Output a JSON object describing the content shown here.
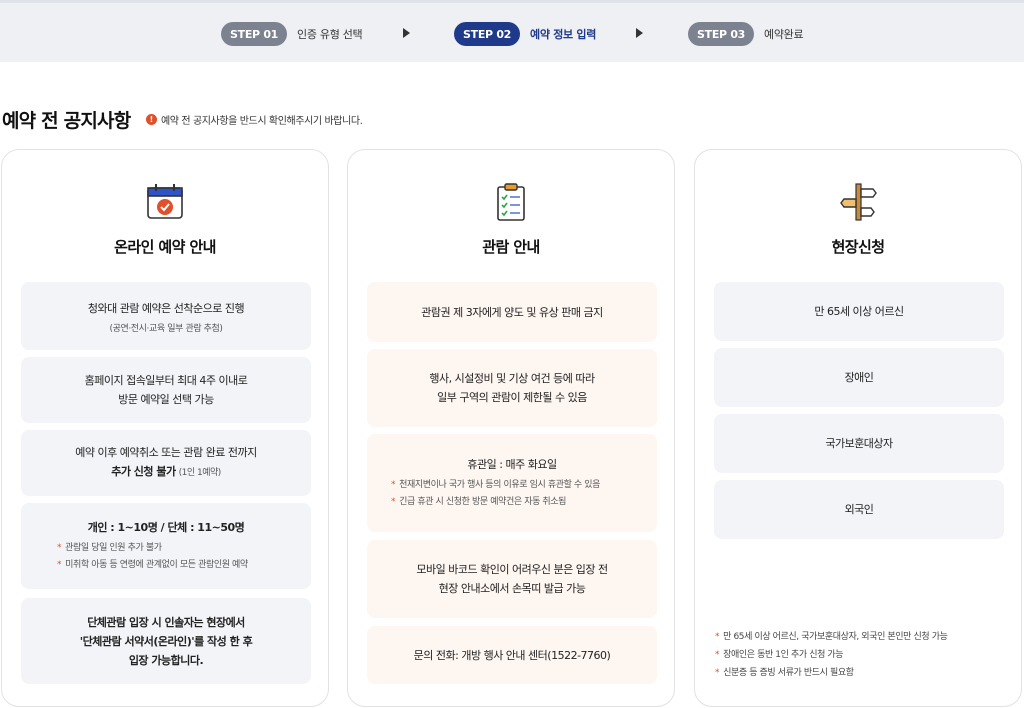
{
  "steps": [
    {
      "badge": "STEP 01",
      "label": "인증 유형 선택"
    },
    {
      "badge": "STEP 02",
      "label": "예약 정보 입력"
    },
    {
      "badge": "STEP 03",
      "label": "예약완료"
    }
  ],
  "section": {
    "title": "예약 전 공지사항",
    "notice_icon": "!",
    "notice": "예약 전 공지사항을 반드시 확인해주시기 바랍니다."
  },
  "online": {
    "icon": "calendar-check-icon",
    "title": "온라인 예약 안내",
    "b1_main": "청와대 관람 예약은 선착순으로 진행",
    "b1_sub": "(공연·전시·교육 일부 관람 추첨)",
    "b2_l1": "홈페이지 접속일부터 최대 4주 이내로",
    "b2_l2": "방문 예약일 선택 가능",
    "b3_l1": "예약 이후 예약취소 또는 관람 완료 전까지",
    "b3_l2": "추가 신청 불가",
    "b3_note": "(1인 1예약)",
    "b4_main": "개인 : 1~10명 / 단체 : 11~50명",
    "b4_bullets": [
      "관람일 당일 인원 추가 불가",
      "미취학 아동 등 연령에 관계없이 모든 관람인원 예약"
    ],
    "b5_l1": "단체관람 입장 시 인솔자는 현장에서",
    "b5_l2": "'단체관람 서약서(온라인)'를 작성 한 후",
    "b5_l3": "입장 가능합니다."
  },
  "viewing": {
    "icon": "clipboard-checklist-icon",
    "title": "관람 안내",
    "b1": "관람권 제 3자에게 양도 및 유상 판매 금지",
    "b2_l1": "행사, 시설정비 및 기상 여건 등에 따라",
    "b2_l2": "일부 구역의 관람이 제한될 수 있음",
    "b3_main": "휴관일 : 매주 화요일",
    "b3_bullets": [
      "천재지변이나 국가 행사 등의 이유로 임시 휴관할 수 있음",
      "긴급 휴관 시 신청한 방문 예약건은 자동 취소됨"
    ],
    "b4_l1": "모바일 바코드 확인이 어려우신 분은 입장 전",
    "b4_l2": "현장 안내소에서 손목띠 발급 가능",
    "b5": "문의 전화: 개방 행사 안내 센터(1522-7760)"
  },
  "onsite": {
    "icon": "signpost-icon",
    "title": "현장신청",
    "items": [
      "만 65세 이상 어르신",
      "장애인",
      "국가보훈대상자",
      "외국인"
    ],
    "notes": [
      "만 65세 이상 어르신, 국가보훈대상자, 외국인 본인만 신청 가능",
      "장애인은 동반 1인 추가 신청 가능",
      "신분증 등 증빙 서류가 반드시 필요함"
    ]
  },
  "colors": {
    "active_step": "#1f3a8a",
    "inactive_step": "#7d8291",
    "accent": "#e0502a"
  }
}
